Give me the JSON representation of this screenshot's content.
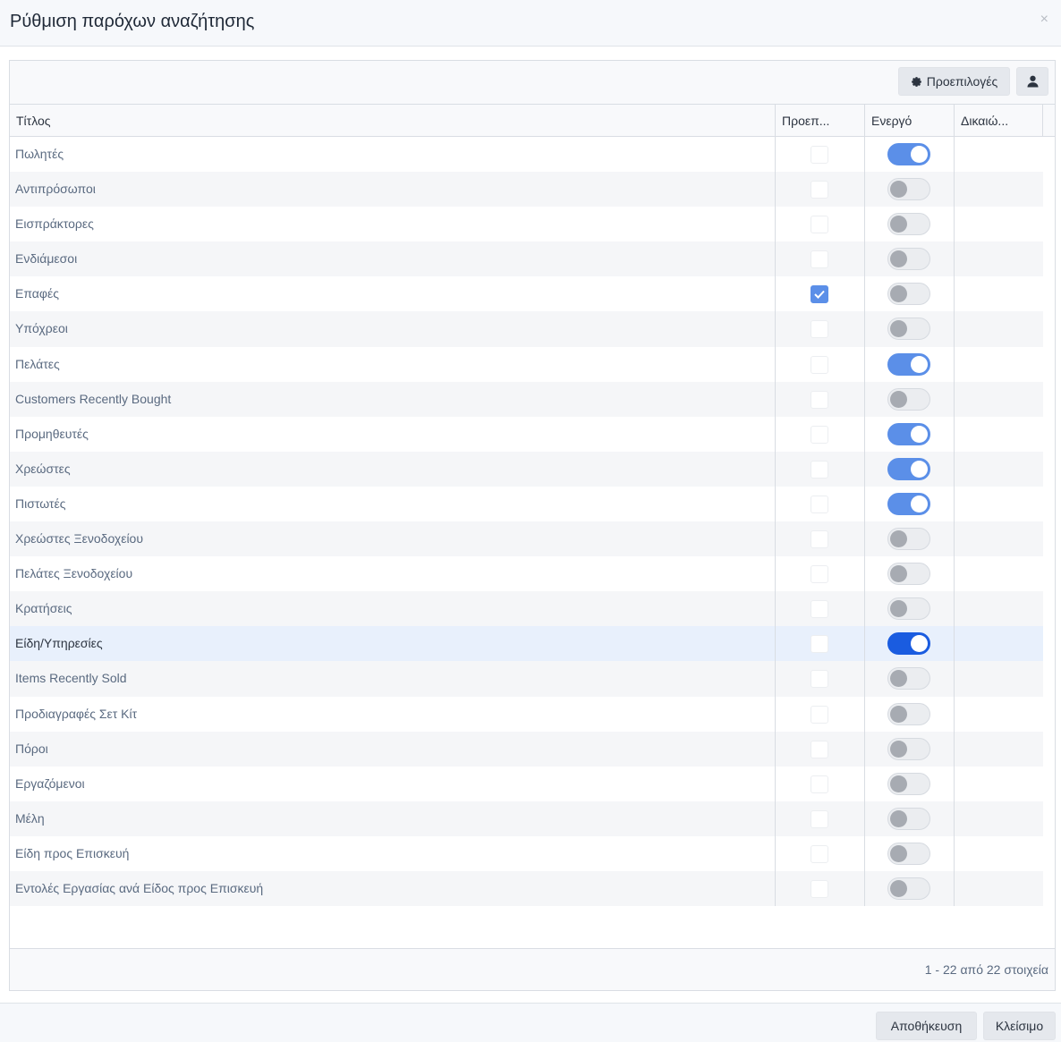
{
  "dialog": {
    "title": "Ρύθμιση παρόχων αναζήτησης",
    "close_glyph": "×"
  },
  "toolbar": {
    "defaults_label": "Προεπιλογές"
  },
  "columns": {
    "title": "Τίτλος",
    "default": "Προεπ...",
    "active": "Ενεργό",
    "rights": "Δικαιώ..."
  },
  "rows": [
    {
      "title": "Πωλητές",
      "default": false,
      "active": true
    },
    {
      "title": "Αντιπρόσωποι",
      "default": false,
      "active": false
    },
    {
      "title": "Εισπράκτορες",
      "default": false,
      "active": false
    },
    {
      "title": "Ενδιάμεσοι",
      "default": false,
      "active": false
    },
    {
      "title": "Επαφές",
      "default": true,
      "active": false
    },
    {
      "title": "Υπόχρεοι",
      "default": false,
      "active": false
    },
    {
      "title": "Πελάτες",
      "default": false,
      "active": true
    },
    {
      "title": "Customers Recently Bought",
      "default": false,
      "active": false
    },
    {
      "title": "Προμηθευτές",
      "default": false,
      "active": true
    },
    {
      "title": "Χρεώστες",
      "default": false,
      "active": true
    },
    {
      "title": "Πιστωτές",
      "default": false,
      "active": true
    },
    {
      "title": "Χρεώστες Ξενοδοχείου",
      "default": false,
      "active": false
    },
    {
      "title": "Πελάτες Ξενοδοχείου",
      "default": false,
      "active": false
    },
    {
      "title": "Κρατήσεις",
      "default": false,
      "active": false
    },
    {
      "title": "Είδη/Υπηρεσίες",
      "default": false,
      "active": true,
      "selected": true
    },
    {
      "title": "Items Recently Sold",
      "default": false,
      "active": false
    },
    {
      "title": "Προδιαγραφές Σετ Κίτ",
      "default": false,
      "active": false
    },
    {
      "title": "Πόροι",
      "default": false,
      "active": false
    },
    {
      "title": "Εργαζόμενοι",
      "default": false,
      "active": false
    },
    {
      "title": "Μέλη",
      "default": false,
      "active": false
    },
    {
      "title": "Είδη προς Επισκευή",
      "default": false,
      "active": false
    },
    {
      "title": "Εντολές Εργασίας ανά Είδος προς Επισκευή",
      "default": false,
      "active": false
    }
  ],
  "pager": {
    "info": "1 - 22 από 22 στοιχεία"
  },
  "actions": {
    "save_label": "Αποθήκευση",
    "close_label": "Κλείσιμο"
  },
  "icons": {
    "defaults": "gear-icon",
    "user": "user-icon",
    "close": "close-icon",
    "check": "check-icon"
  },
  "colors": {
    "accent": "#5b8fe8",
    "accent_selected": "#1a5ce0",
    "toggle_off": "#ebedf0",
    "knob_off": "#a7abb2"
  }
}
